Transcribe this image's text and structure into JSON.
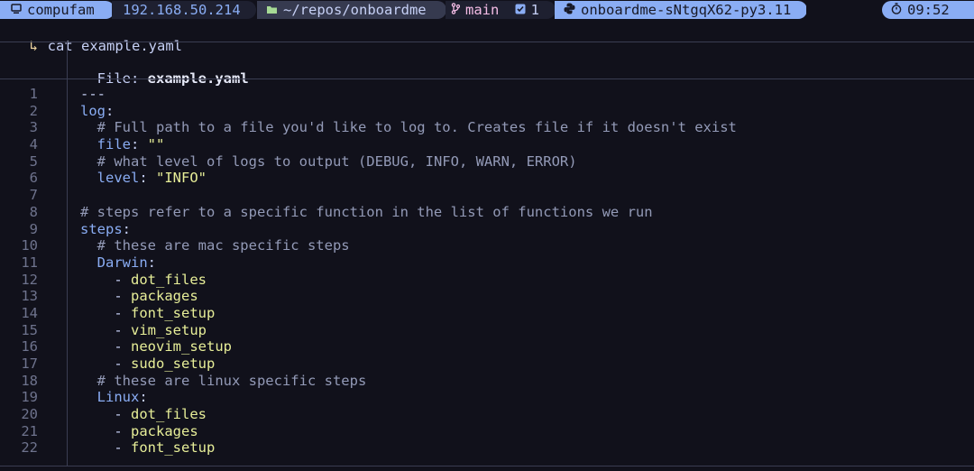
{
  "prompt": {
    "host": "compufam",
    "ip": "192.168.50.214",
    "directory": "~/repos/onboardme",
    "git_branch": "main",
    "git_status_count": "1",
    "python_env": "onboardme-sNtgqX62-py3.11",
    "time": "09:52",
    "icons": {
      "host": "computer-icon",
      "directory": "folder-icon",
      "git": "git-branch-icon",
      "status": "checkbox-icon",
      "python": "python-icon",
      "time": "stopwatch-icon"
    },
    "colors": {
      "accent_blue": "#8aadf4",
      "accent_pink": "#f5bde6",
      "string_yellow": "#e7ee98"
    }
  },
  "command": {
    "arrow": "↳",
    "text": "cat example.yaml"
  },
  "file_header": {
    "label": "File: ",
    "filename": "example.yaml"
  },
  "lines": [
    {
      "num": "1",
      "indent": "",
      "parts": [
        {
          "t": "---",
          "c": "doc"
        }
      ]
    },
    {
      "num": "2",
      "indent": "",
      "parts": [
        {
          "t": "log",
          "c": "key"
        },
        {
          "t": ":",
          "c": "punct"
        }
      ]
    },
    {
      "num": "3",
      "indent": "  ",
      "parts": [
        {
          "t": "# Full path to a file you'd like to log to. Creates file if it doesn't exist",
          "c": "comment"
        }
      ]
    },
    {
      "num": "4",
      "indent": "  ",
      "parts": [
        {
          "t": "file",
          "c": "key"
        },
        {
          "t": ": ",
          "c": "punct"
        },
        {
          "t": "\"\"",
          "c": "str"
        }
      ]
    },
    {
      "num": "5",
      "indent": "  ",
      "parts": [
        {
          "t": "# what level of logs to output (DEBUG, INFO, WARN, ERROR)",
          "c": "comment"
        }
      ]
    },
    {
      "num": "6",
      "indent": "  ",
      "parts": [
        {
          "t": "level",
          "c": "key"
        },
        {
          "t": ": ",
          "c": "punct"
        },
        {
          "t": "\"INFO\"",
          "c": "str"
        }
      ]
    },
    {
      "num": "7",
      "indent": "",
      "parts": []
    },
    {
      "num": "8",
      "indent": "",
      "parts": [
        {
          "t": "# steps refer to a specific function in the list of functions we run",
          "c": "comment"
        }
      ]
    },
    {
      "num": "9",
      "indent": "",
      "parts": [
        {
          "t": "steps",
          "c": "key"
        },
        {
          "t": ":",
          "c": "punct"
        }
      ]
    },
    {
      "num": "10",
      "indent": "  ",
      "parts": [
        {
          "t": "# these are mac specific steps",
          "c": "comment"
        }
      ]
    },
    {
      "num": "11",
      "indent": "  ",
      "parts": [
        {
          "t": "Darwin",
          "c": "key"
        },
        {
          "t": ":",
          "c": "punct"
        }
      ]
    },
    {
      "num": "12",
      "indent": "    ",
      "parts": [
        {
          "t": "- ",
          "c": "dash"
        },
        {
          "t": "dot_files",
          "c": "item"
        }
      ]
    },
    {
      "num": "13",
      "indent": "    ",
      "parts": [
        {
          "t": "- ",
          "c": "dash"
        },
        {
          "t": "packages",
          "c": "item"
        }
      ]
    },
    {
      "num": "14",
      "indent": "    ",
      "parts": [
        {
          "t": "- ",
          "c": "dash"
        },
        {
          "t": "font_setup",
          "c": "item"
        }
      ]
    },
    {
      "num": "15",
      "indent": "    ",
      "parts": [
        {
          "t": "- ",
          "c": "dash"
        },
        {
          "t": "vim_setup",
          "c": "item"
        }
      ]
    },
    {
      "num": "16",
      "indent": "    ",
      "parts": [
        {
          "t": "- ",
          "c": "dash"
        },
        {
          "t": "neovim_setup",
          "c": "item"
        }
      ]
    },
    {
      "num": "17",
      "indent": "    ",
      "parts": [
        {
          "t": "- ",
          "c": "dash"
        },
        {
          "t": "sudo_setup",
          "c": "item"
        }
      ]
    },
    {
      "num": "18",
      "indent": "  ",
      "parts": [
        {
          "t": "# these are linux specific steps",
          "c": "comment"
        }
      ]
    },
    {
      "num": "19",
      "indent": "  ",
      "parts": [
        {
          "t": "Linux",
          "c": "key"
        },
        {
          "t": ":",
          "c": "punct"
        }
      ]
    },
    {
      "num": "20",
      "indent": "    ",
      "parts": [
        {
          "t": "- ",
          "c": "dash"
        },
        {
          "t": "dot_files",
          "c": "item"
        }
      ]
    },
    {
      "num": "21",
      "indent": "    ",
      "parts": [
        {
          "t": "- ",
          "c": "dash"
        },
        {
          "t": "packages",
          "c": "item"
        }
      ]
    },
    {
      "num": "22",
      "indent": "    ",
      "parts": [
        {
          "t": "- ",
          "c": "dash"
        },
        {
          "t": "font_setup",
          "c": "item"
        }
      ]
    }
  ]
}
